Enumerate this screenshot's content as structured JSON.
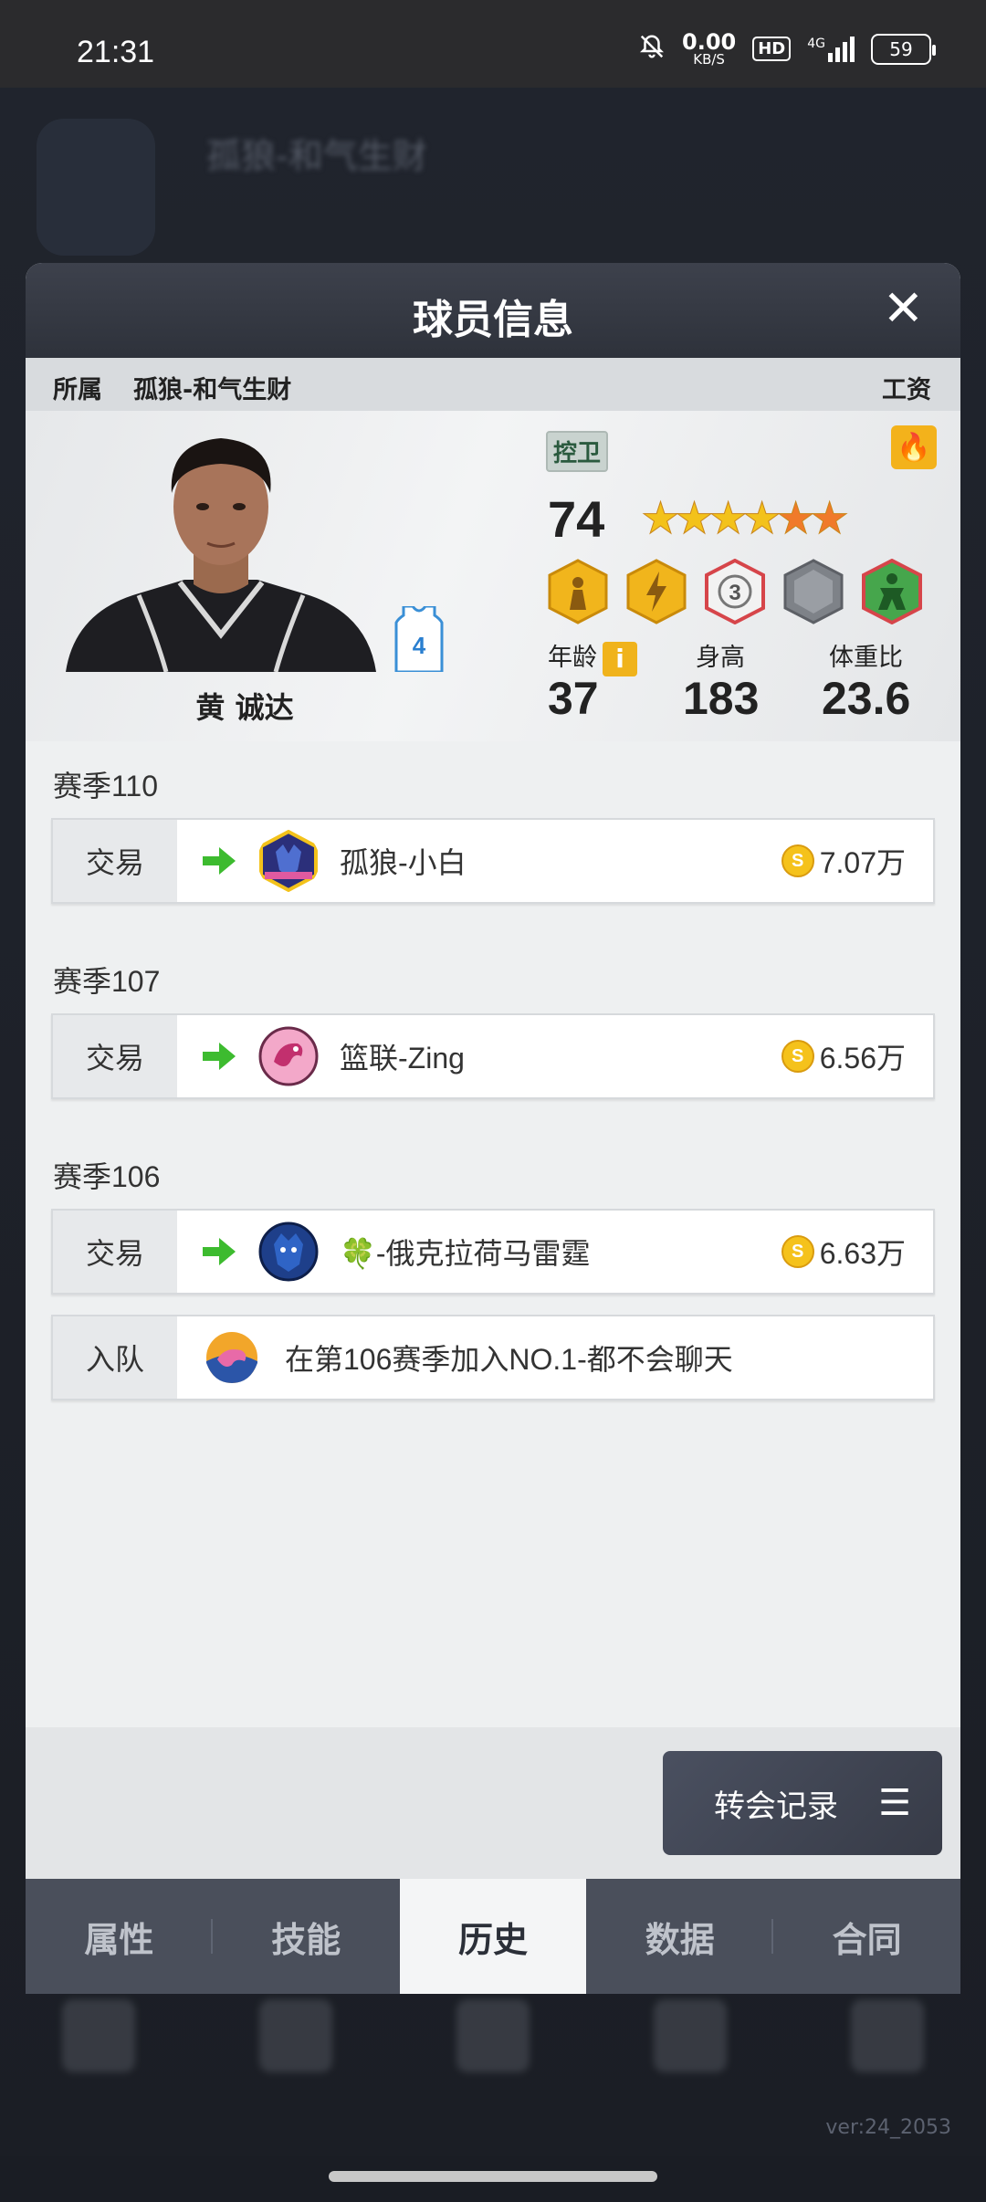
{
  "status_bar": {
    "time": "21:31",
    "net_speed_value": "0.00",
    "net_speed_unit": "KB/S",
    "hd": "HD",
    "network": "4G",
    "battery": "59"
  },
  "background": {
    "team_title": "孤狼-和气生财",
    "version": "ver:24_2053"
  },
  "modal": {
    "title": "球员信息",
    "close": "✕",
    "affiliation_label": "所属",
    "affiliation_team": "孤狼-和气生财",
    "salary_label": "工资"
  },
  "player": {
    "name": "黄 诚达",
    "jersey_number": "4",
    "position": "控卫",
    "overall": "74",
    "stars_gold": 4,
    "stars_orange": 2,
    "age_label": "年龄",
    "age_value": "37",
    "height_label": "身高",
    "height_value": "183",
    "ratio_label": "体重比",
    "ratio_value": "23.6",
    "info_icon": "i"
  },
  "history": [
    {
      "season": "赛季110",
      "entries": [
        {
          "type": "交易",
          "team": "孤狼-小白",
          "fee": "7.07万",
          "logo_color": "#2b2f7a"
        }
      ]
    },
    {
      "season": "赛季107",
      "entries": [
        {
          "type": "交易",
          "team": "篮联-Zing",
          "fee": "6.56万",
          "logo_color": "#e98fb6"
        }
      ]
    },
    {
      "season": "赛季106",
      "entries": [
        {
          "type": "交易",
          "team": "🍀-俄克拉荷马雷霆",
          "fee": "6.63万",
          "logo_color": "#1e3f8a"
        }
      ],
      "join": {
        "type": "入队",
        "text": "在第106赛季加入NO.1-都不会聊天"
      }
    }
  ],
  "transfer_button": "转会记录",
  "tabs": [
    "属性",
    "技能",
    "历史",
    "数据",
    "合同"
  ],
  "active_tab": "历史",
  "colors": {
    "accent_gold": "#f3b21b",
    "header_dark": "#2e323b",
    "arrow_green": "#3dbb2f"
  }
}
